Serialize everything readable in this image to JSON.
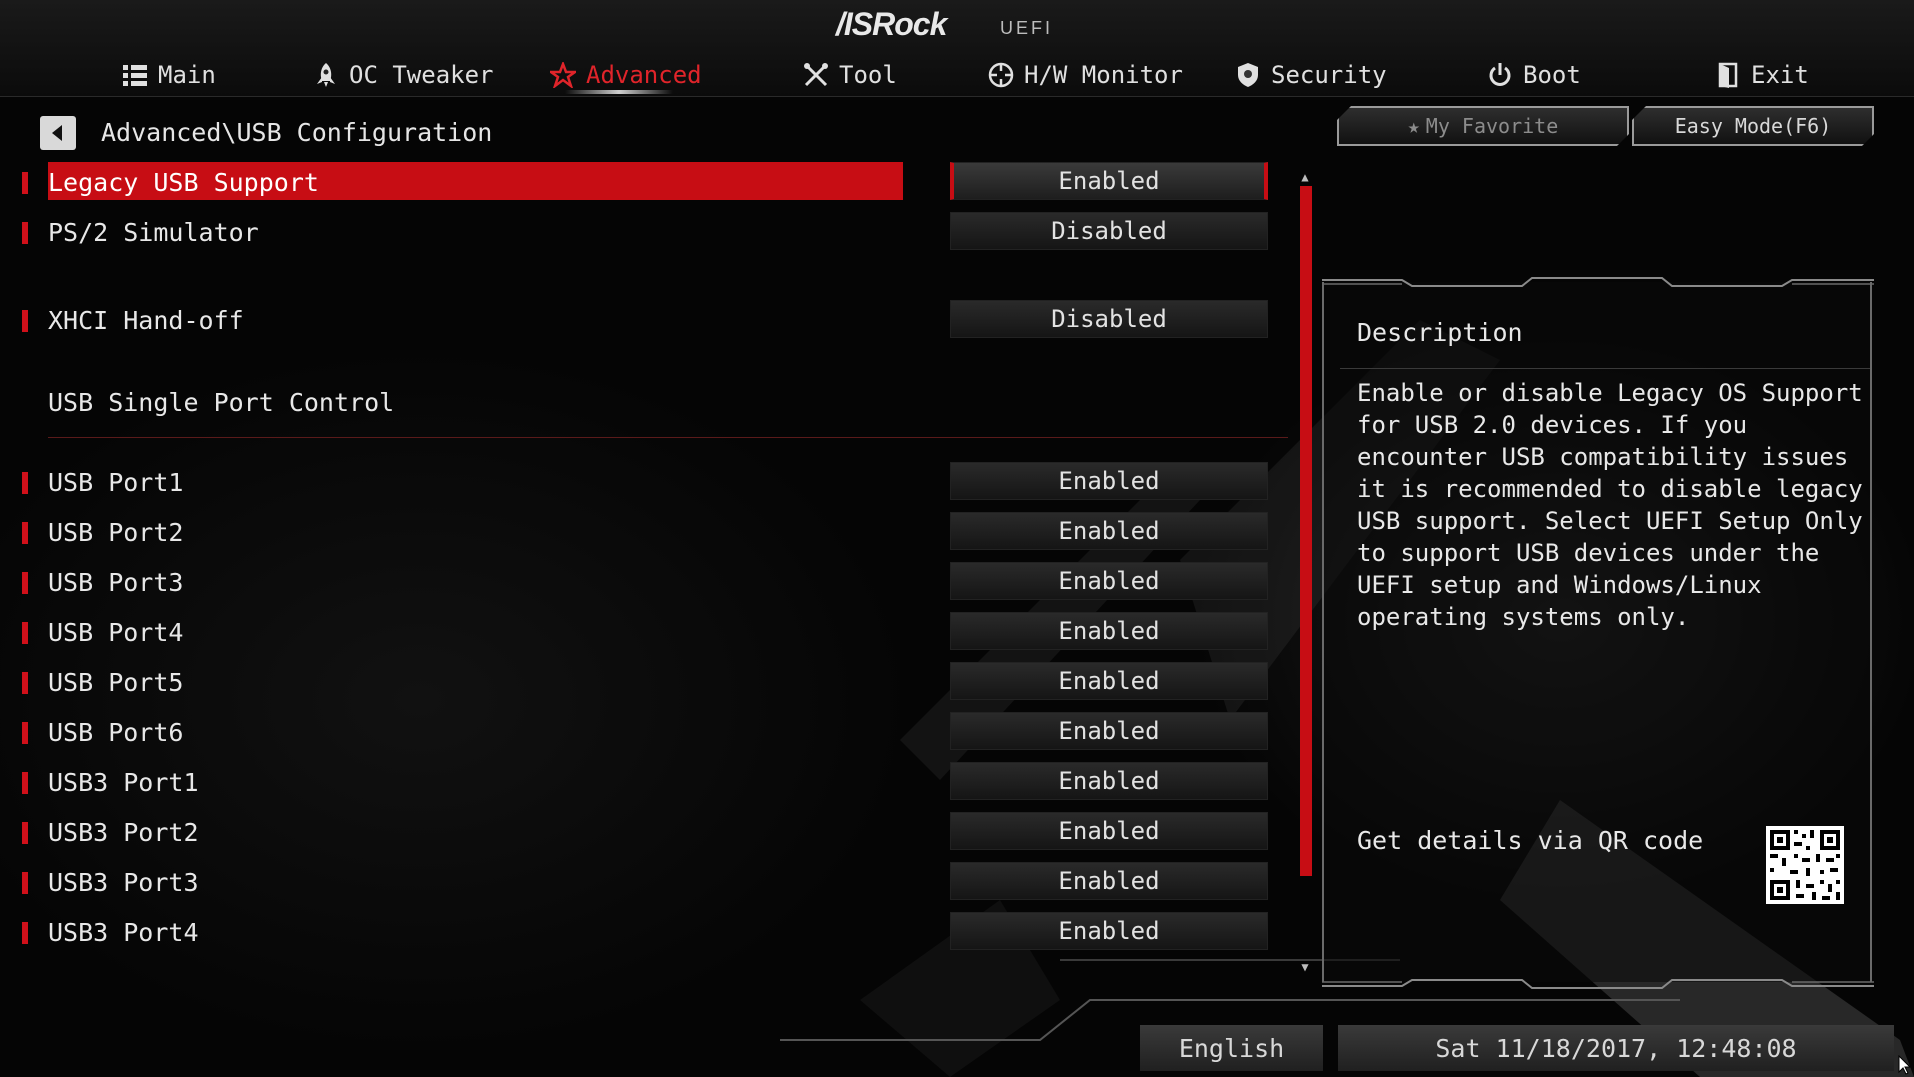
{
  "header": {
    "logo": "/ISRock",
    "logo_sub": "UEFI",
    "tabs": [
      {
        "label": "Main",
        "icon": "list-icon"
      },
      {
        "label": "OC Tweaker",
        "icon": "rocket-icon"
      },
      {
        "label": "Advanced",
        "icon": "star-icon",
        "active": true
      },
      {
        "label": "Tool",
        "icon": "tools-icon"
      },
      {
        "label": "H/W Monitor",
        "icon": "monitor-icon"
      },
      {
        "label": "Security",
        "icon": "shield-icon"
      },
      {
        "label": "Boot",
        "icon": "power-icon"
      },
      {
        "label": "Exit",
        "icon": "exit-icon"
      }
    ]
  },
  "breadcrumb": "Advanced\\USB Configuration",
  "buttons": {
    "favorite": "My Favorite",
    "easy_mode": "Easy Mode(F6)"
  },
  "settings": [
    {
      "label": "Legacy USB Support",
      "value": "Enabled",
      "selected": true
    },
    {
      "label": "PS/2 Simulator",
      "value": "Disabled"
    },
    {
      "label": "XHCI Hand-off",
      "value": "Disabled"
    }
  ],
  "section_title": "USB Single Port Control",
  "ports": [
    {
      "label": "USB Port1",
      "value": "Enabled"
    },
    {
      "label": "USB Port2",
      "value": "Enabled"
    },
    {
      "label": "USB Port3",
      "value": "Enabled"
    },
    {
      "label": "USB Port4",
      "value": "Enabled"
    },
    {
      "label": "USB Port5",
      "value": "Enabled"
    },
    {
      "label": "USB Port6",
      "value": "Enabled"
    },
    {
      "label": "USB3 Port1",
      "value": "Enabled"
    },
    {
      "label": "USB3 Port2",
      "value": "Enabled"
    },
    {
      "label": "USB3 Port3",
      "value": "Enabled"
    },
    {
      "label": "USB3 Port4",
      "value": "Enabled"
    }
  ],
  "description": {
    "title": "Description",
    "text": "Enable or disable Legacy OS Support\nfor USB 2.0 devices. If you\nencounter USB compatibility issues\nit is recommended to disable legacy\nUSB support. Select UEFI Setup Only\nto support USB devices under the\nUEFI setup and Windows/Linux\noperating systems only.",
    "qr_label": "Get details via QR code"
  },
  "footer": {
    "language": "English",
    "datetime": "Sat 11/18/2017, 12:48:08"
  },
  "colors": {
    "accent": "#c70d14",
    "text": "#e8e8e8",
    "background": "#050505"
  }
}
